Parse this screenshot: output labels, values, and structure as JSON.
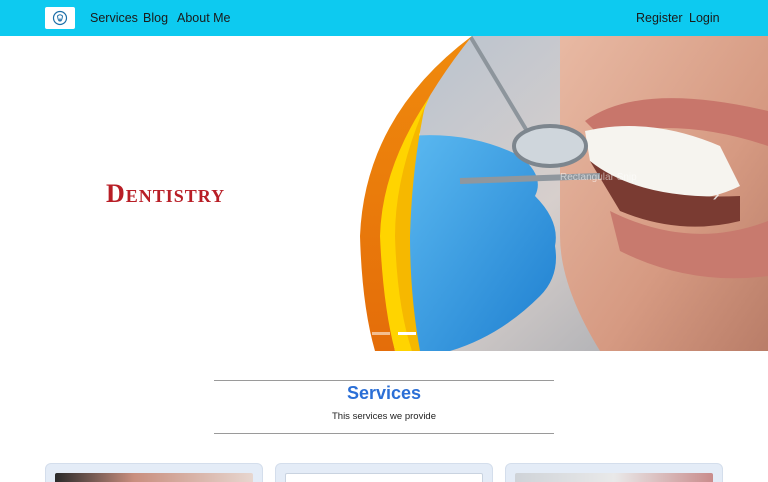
{
  "navbar": {
    "logo_icon": "tooth-logo-icon",
    "links": [
      {
        "label": "Services"
      },
      {
        "label": "Blog"
      },
      {
        "label": "About Me"
      }
    ],
    "register_label": "Register",
    "login_label": "Login",
    "background_color": "#0dcaf0"
  },
  "hero": {
    "title": "Dentistry",
    "overlay_caption": "Rectangular Snip",
    "next_icon": "chevron-right-icon",
    "indicators": 2,
    "title_color": "#b81e26"
  },
  "services_section": {
    "title": "Services",
    "subtitle": "This services we provide",
    "title_color": "#2b6fd6"
  },
  "cards": [
    {
      "name": "service-card-1"
    },
    {
      "name": "service-card-2"
    },
    {
      "name": "service-card-3"
    }
  ]
}
